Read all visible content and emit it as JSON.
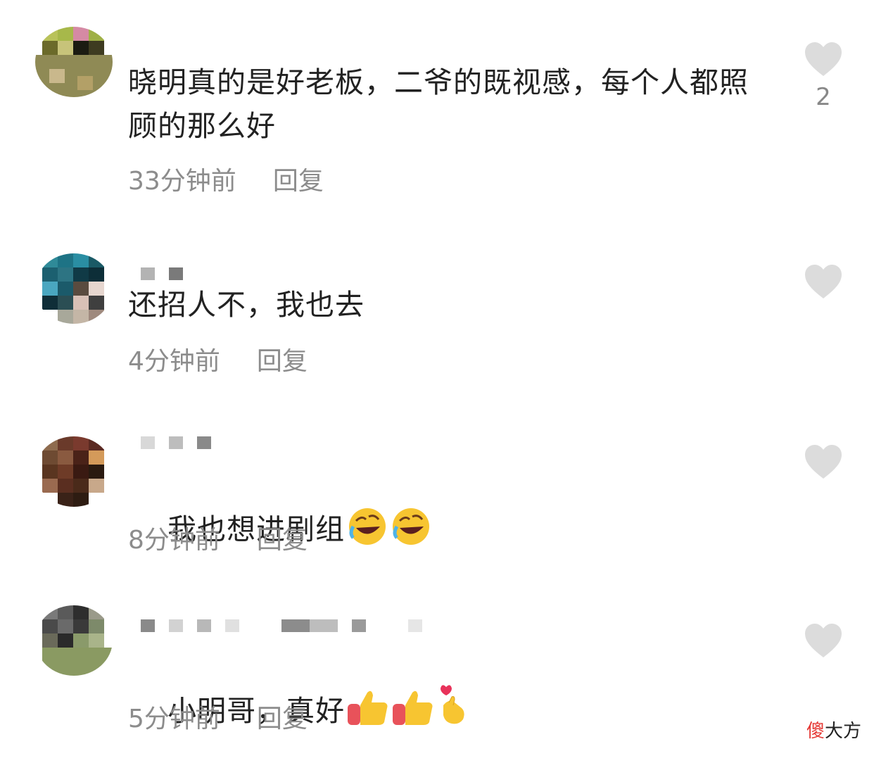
{
  "comments": [
    {
      "text": "晓明真的是好老板，二爷的既视感，每个人都照顾的那么好",
      "time": "33分钟前",
      "reply": "回复",
      "likes": "2"
    },
    {
      "text": "还招人不，我也去",
      "time": "4分钟前",
      "reply": "回复",
      "likes": ""
    },
    {
      "text": "我也想进剧组",
      "emojis": [
        "rofl-emoji",
        "rofl-emoji"
      ],
      "time": "8分钟前",
      "reply": "回复",
      "likes": ""
    },
    {
      "text": "小明哥，真好",
      "emojis": [
        "thumbs-up-emoji",
        "thumbs-up-emoji",
        "finger-heart-emoji"
      ],
      "time": "5分钟前",
      "reply": "回复",
      "likes": ""
    }
  ],
  "watermark": {
    "part1": "傻",
    "part2": "大方"
  },
  "colors": {
    "heart": "#dcdcdc",
    "meta": "#8c8c8c",
    "text": "#222222",
    "watermark_accent": "#e53935"
  }
}
